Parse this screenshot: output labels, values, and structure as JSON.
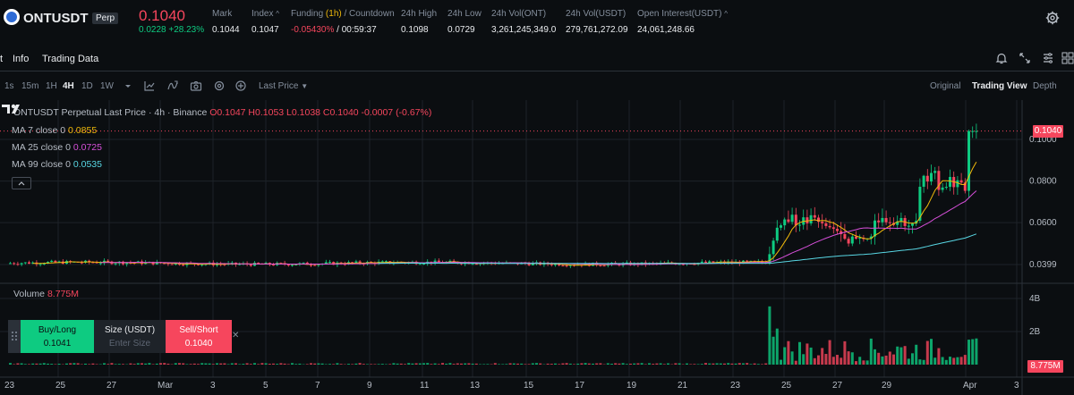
{
  "ticker": {
    "symbol": "ONTUSDT",
    "badge": "Perp",
    "last_price": "0.1040",
    "change": "0.0228 +28.23%",
    "stats": [
      {
        "key": "mark",
        "label": "Mark",
        "value": "0.1044"
      },
      {
        "key": "index",
        "label": "Index",
        "value": "0.1047"
      },
      {
        "key": "funding",
        "label": "Funding",
        "label_hl": "(1h)",
        "label_tail": " / Countdown",
        "value": "-0.05430%",
        "value_tail": " / 00:59:37"
      },
      {
        "key": "high",
        "label": "24h High",
        "value": "0.1098"
      },
      {
        "key": "low",
        "label": "24h Low",
        "value": "0.0729"
      },
      {
        "key": "volont",
        "label": "24h Vol(ONT)",
        "value": "3,261,245,349.0"
      },
      {
        "key": "volusdt",
        "label": "24h Vol(USDT)",
        "value": "279,761,272.09"
      },
      {
        "key": "oi",
        "label": "Open Interest(USDT)",
        "value": "24,061,248.66"
      }
    ]
  },
  "tabs": {
    "items": [
      "t",
      "Info",
      "Trading Data"
    ]
  },
  "toolbar": {
    "timeframes": [
      "1s",
      "15m",
      "1H",
      "4H",
      "1D",
      "1W"
    ],
    "active_timeframe": "4H",
    "price_type": "Last Price",
    "views": [
      "Original",
      "Trading View",
      "Depth"
    ],
    "active_view": "Trading View"
  },
  "chart": {
    "title": "ONTUSDT Perpetual Last Price · 4h · Binance",
    "ohlc": "O0.1047 H0.1053 L0.1038 C0.1040 -0.0007 (-0.67%)",
    "ma": [
      {
        "label": "MA 7 close 0",
        "value": "0.0855",
        "color": "#f0b90b"
      },
      {
        "label": "MA 25 close 0",
        "value": "0.0725",
        "color": "#d64fd9"
      },
      {
        "label": "MA 99 close 0",
        "value": "0.0535",
        "color": "#58d7e4"
      }
    ],
    "volume_label": "Volume",
    "volume_value": "8.775M",
    "price_tag": "0.1040",
    "volume_tag": "8.775M",
    "price_axis": [
      "0.1000",
      "0.0800",
      "0.0600",
      "0.0399"
    ],
    "volume_axis": [
      "4B",
      "2B"
    ],
    "date_axis": [
      "23",
      "25",
      "27",
      "Mar",
      "3",
      "5",
      "7",
      "9",
      "11",
      "13",
      "15",
      "17",
      "19",
      "21",
      "23",
      "25",
      "27",
      "29",
      "Apr",
      "3"
    ],
    "colors": {
      "up": "#0ecb81",
      "down": "#f6465d",
      "grid": "#1e2329"
    }
  },
  "order": {
    "buy_label": "Buy/Long",
    "buy_price": "0.1041",
    "size_label": "Size (USDT)",
    "size_placeholder": "Enter Size",
    "sell_label": "Sell/Short",
    "sell_price": "0.1040"
  },
  "icons": [
    "gear-icon",
    "bell-icon",
    "swap-icon",
    "settings-icon",
    "grid-icon",
    "candle-type-icon",
    "indicators-icon",
    "camera-icon",
    "settings-icon",
    "replay-icon",
    "chevron-down-icon",
    "close-icon",
    "chevron-up-icon"
  ]
}
